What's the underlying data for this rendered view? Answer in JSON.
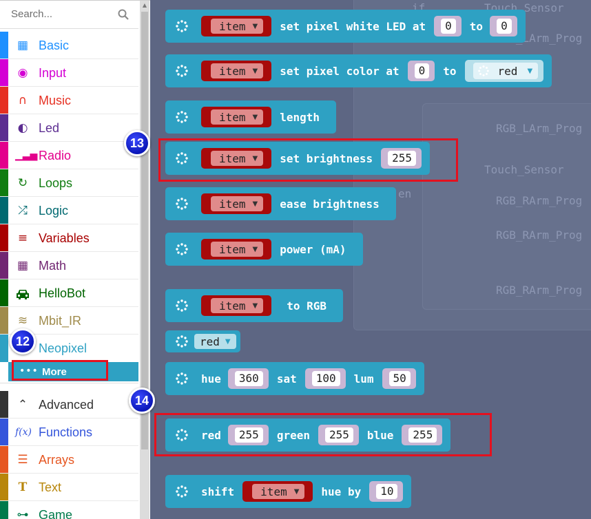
{
  "search": {
    "placeholder": "Search..."
  },
  "categories": [
    {
      "label": "Basic",
      "color": "#1e90ff",
      "icon": "grid-icon"
    },
    {
      "label": "Input",
      "color": "#d400d4",
      "icon": "target-icon"
    },
    {
      "label": "Music",
      "color": "#e63022",
      "icon": "headphones-icon"
    },
    {
      "label": "Led",
      "color": "#5c2d91",
      "icon": "toggle-icon"
    },
    {
      "label": "Radio",
      "color": "#e3008c",
      "icon": "signal-icon"
    },
    {
      "label": "Loops",
      "color": "#107c10",
      "icon": "refresh-icon"
    },
    {
      "label": "Logic",
      "color": "#006970",
      "icon": "shuffle-icon"
    },
    {
      "label": "Variables",
      "color": "#a80000",
      "icon": "list-icon"
    },
    {
      "label": "Math",
      "color": "#712672",
      "icon": "calculator-icon"
    },
    {
      "label": "HelloBot",
      "color": "#006400",
      "icon": "car-icon"
    },
    {
      "label": "Mbit_IR",
      "color": "#a08b4b",
      "icon": "wifi-icon"
    },
    {
      "label": "Neopixel",
      "color": "#2ea1c3",
      "icon": "neopixel-icon"
    }
  ],
  "more": {
    "label": "More",
    "icon": "dots-icon"
  },
  "advanced_categories": [
    {
      "label": "Advanced",
      "color": "#333333",
      "icon": "chevron-up-icon"
    },
    {
      "label": "Functions",
      "color": "#3455db",
      "icon": "function-icon"
    },
    {
      "label": "Arrays",
      "color": "#e65722",
      "icon": "list-ordered-icon"
    },
    {
      "label": "Text",
      "color": "#b8860b",
      "icon": "text-icon"
    },
    {
      "label": "Game",
      "color": "#007a4b",
      "icon": "gamepad-icon"
    }
  ],
  "background_blocks": {
    "labels": [
      "if",
      "Touch_Sensor",
      "RGB_LArm_Prog",
      "RGB_LArm_Prog",
      "Touch_Sensor",
      "RGB_RArm_Prog",
      "RGB_RArm_Prog",
      "RGB_RArm_Prog",
      "en"
    ]
  },
  "blocks": {
    "var_name": "item",
    "set_white_led": {
      "text": "set pixel white LED at",
      "to": "to",
      "at_value": "0",
      "to_value": "0"
    },
    "set_pixel_color": {
      "text": "set pixel color at",
      "to": "to",
      "at_value": "0",
      "color": "red"
    },
    "length": {
      "text": "length"
    },
    "set_brightness": {
      "text": "set brightness",
      "value": "255"
    },
    "ease_brightness": {
      "text": "ease brightness"
    },
    "power": {
      "text": "power (mA)"
    },
    "to_rgb": {
      "text": "to RGB"
    },
    "color_red": {
      "color": "red"
    },
    "hsl": {
      "hue": "hue",
      "hue_value": "360",
      "sat": "sat",
      "sat_value": "100",
      "lum": "lum",
      "lum_value": "50"
    },
    "rgb": {
      "red": "red",
      "red_value": "255",
      "green": "green",
      "green_value": "255",
      "blue": "blue",
      "blue_value": "255"
    },
    "shift": {
      "text": "shift",
      "hue_by": "hue by",
      "value": "10"
    }
  },
  "annotations": {
    "badge12": "12",
    "badge13": "13",
    "badge14": "14"
  },
  "colors": {
    "neopixel": "#2ea1c3",
    "variable": "#a80a0a",
    "workspace": "#5d6683",
    "highlight": "#e4111f",
    "badge": "#0b17b8"
  }
}
